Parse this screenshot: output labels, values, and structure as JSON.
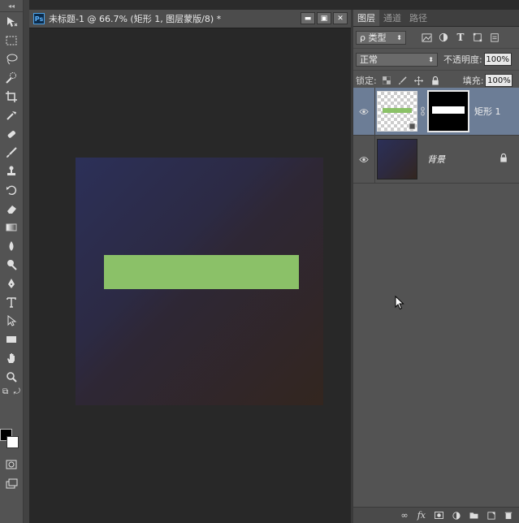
{
  "document": {
    "ps_badge": "Ps",
    "title": "未标题-1 @ 66.7% (矩形 1, 图层蒙版/8) *",
    "window_buttons": [
      "▬",
      "▣",
      "✕"
    ]
  },
  "canvas": {
    "gradient_colors": [
      "#2c3058",
      "#2e2735",
      "#33261f"
    ],
    "shape_color": "#8bc168"
  },
  "toolbar": {
    "top_arrows": "◂◂",
    "tools": [
      {
        "name": "move-tool",
        "glyph": "✥"
      },
      {
        "name": "marquee-tool",
        "glyph": "⬚"
      },
      {
        "name": "lasso-tool",
        "glyph": "◌"
      },
      {
        "name": "quick-select-tool",
        "glyph": "✎"
      },
      {
        "name": "crop-tool",
        "glyph": "⌗"
      },
      {
        "name": "eyedropper-tool",
        "glyph": "⁄"
      },
      {
        "name": "healing-brush-tool",
        "glyph": "✚"
      },
      {
        "name": "brush-tool",
        "glyph": "✐"
      },
      {
        "name": "stamp-tool",
        "glyph": "⊥"
      },
      {
        "name": "history-brush-tool",
        "glyph": "↺"
      },
      {
        "name": "eraser-tool",
        "glyph": "▱"
      },
      {
        "name": "gradient-tool",
        "glyph": "▭"
      },
      {
        "name": "blur-tool",
        "glyph": "●"
      },
      {
        "name": "dodge-tool",
        "glyph": "⚲"
      },
      {
        "name": "pen-tool",
        "glyph": "✒"
      },
      {
        "name": "type-tool",
        "glyph": "T"
      },
      {
        "name": "path-select-tool",
        "glyph": "➤"
      },
      {
        "name": "rectangle-tool",
        "glyph": "▭"
      },
      {
        "name": "hand-tool",
        "glyph": "✋"
      },
      {
        "name": "zoom-tool",
        "glyph": "⚲"
      }
    ],
    "foreground_color": "#000000",
    "background_color": "#ffffff"
  },
  "panel": {
    "tabs": [
      "图层",
      "通道",
      "路径"
    ],
    "filter_label": "ρ 类型",
    "blend_mode": "正常",
    "opacity_label": "不透明度:",
    "opacity_value": "100%",
    "lock_label": "锁定:",
    "fill_label": "填充:",
    "fill_value": "100%",
    "layers": [
      {
        "name": "矩形 1"
      },
      {
        "name": "背景"
      }
    ]
  }
}
